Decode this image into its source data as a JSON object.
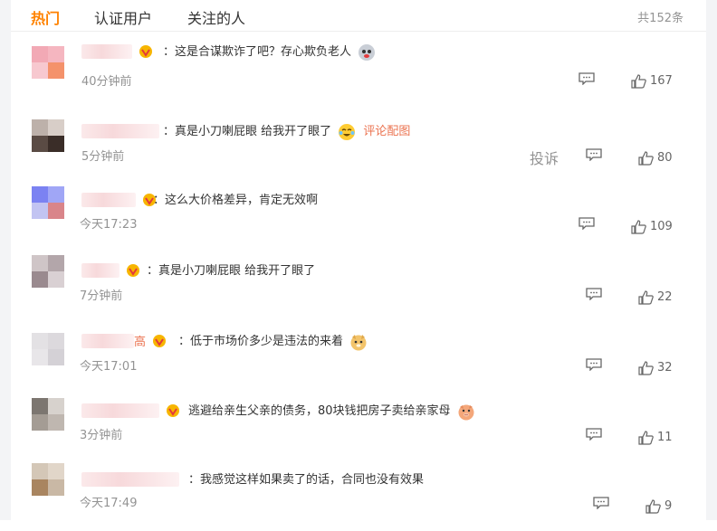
{
  "tabs": [
    "热门",
    "认证用户",
    "关注的人"
  ],
  "total": "共152条",
  "comments": [
    {
      "name_suffix": "",
      "text": "：这是合谋欺诈了吧？存心欺负老人",
      "emoji": "face-icon",
      "extra": "",
      "time": "40分钟前",
      "likes": "167",
      "report": ""
    },
    {
      "name_suffix": "",
      "text": "：真是小刀喇屁眼 给我开了眼了",
      "emoji": "laugh-cry-icon",
      "extra": "评论配图",
      "time": "5分钟前",
      "likes": "80",
      "report": "投诉"
    },
    {
      "name_suffix": "",
      "text": "：这么大价格差异，肯定无效啊",
      "emoji": "",
      "extra": "",
      "time": "今天17:23",
      "likes": "109",
      "report": ""
    },
    {
      "name_suffix": "",
      "text": "：真是小刀喇屁眼 给我开了眼了",
      "emoji": "",
      "extra": "",
      "time": "7分钟前",
      "likes": "22",
      "report": ""
    },
    {
      "name_suffix": "高",
      "text": "：低于市场价多少是违法的来着",
      "emoji": "doge-icon",
      "extra": "",
      "time": "今天17:01",
      "likes": "32",
      "report": ""
    },
    {
      "name_suffix": "",
      "text": "逃避给亲生父亲的债务，80块钱把房子卖给亲家母",
      "emoji": "pig-icon",
      "extra": "",
      "time": "3分钟前",
      "likes": "11",
      "report": ""
    },
    {
      "name_suffix": "",
      "text": "：我感觉这样如果卖了的话，合同也没有效果",
      "emoji": "",
      "extra": "",
      "time": "今天17:49",
      "likes": "9",
      "report": ""
    }
  ],
  "colors": {
    "accent": "#ff8200",
    "link": "#eb7350",
    "muted": "#939393"
  }
}
